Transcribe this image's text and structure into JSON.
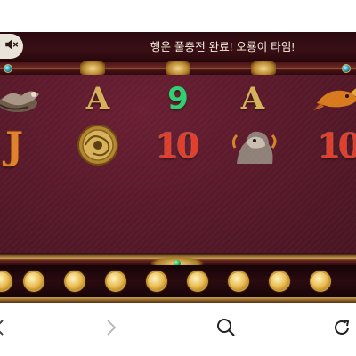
{
  "game": {
    "announcement": "행운 풀충전 완료! 오룡이 타임!",
    "sound_icon": "speaker-muted-icon",
    "reels": [
      {
        "row": 1,
        "symbols": [
          "dragon-icon",
          "A",
          "9",
          "A",
          "golden-carp-icon"
        ]
      },
      {
        "row": 2,
        "symbols": [
          "J",
          "coin-medallion-icon",
          "10",
          "guardian-lion-icon",
          "10"
        ]
      }
    ],
    "coin_slots": 9
  },
  "browser_nav": {
    "back_icon": "chevron-left-icon",
    "forward_icon": "chevron-right-icon",
    "search_icon": "search-icon",
    "reload_icon": "reload-icon"
  }
}
